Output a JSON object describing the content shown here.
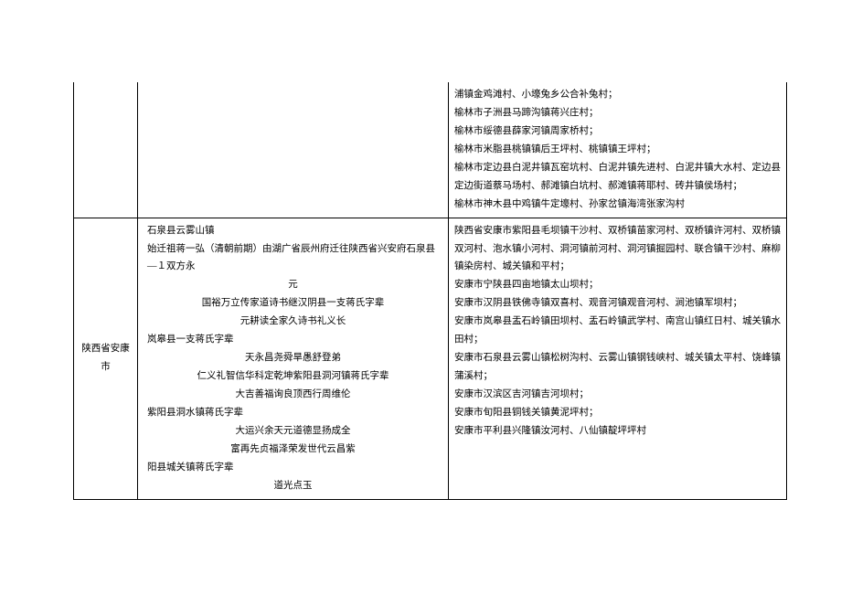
{
  "row1": {
    "col1": "",
    "col2": "",
    "col3_lines": [
      "浦镇金鸡滩村、小壕兔乡公合补兔村；",
      "榆林市子洲县马蹄沟镇蒋兴庄村；",
      "榆林市绥德县薛家河镇周家桥村；",
      "榆林市米脂县桃镇镇后王坪村、桃镇镇王坪村；",
      "榆林市定边县白泥井镇瓦窑坑村、白泥井镇先进村、白泥井镇大水村、定边县定边街道蔡马场村、郝滩镇白坑村、郝滩镇蒋耶村、砖井镇侯场村；",
      "榆林市神木县中鸡镇牛定壕村、孙家岔镇海湾张家沟村"
    ]
  },
  "row2": {
    "col1": "陕西省安康市",
    "col2_lines": [
      {
        "cls": "left-line",
        "text": "石泉县云雾山镇"
      },
      {
        "cls": "left-line",
        "text": "始迁祖蒋一弘（清朝前期）由湖广省辰州府迁往陕西省兴安府石泉县—１双方永"
      },
      {
        "cls": "indent-center",
        "text": "元"
      },
      {
        "cls": "indent-center",
        "text": "国裕万立传家道诗书继汉阴县一支蒋氏字辈"
      },
      {
        "cls": "indent-center",
        "text": "元耕读全家久诗书礼义长"
      },
      {
        "cls": "left-line",
        "text": "岚皋县一支蒋氏字辈"
      },
      {
        "cls": "indent-center",
        "text": "天永昌尧舜旱愚舒登弟"
      },
      {
        "cls": "indent-center",
        "text": "仁义礼智信华科定乾坤紫阳县洞河镇蒋氏字辈"
      },
      {
        "cls": "indent-center",
        "text": "大吉善福询良顶西行周维伦"
      },
      {
        "cls": "left-line",
        "text": "紫阳县洞水镇蒋氏字辈"
      },
      {
        "cls": "indent-center",
        "text": "大运兴余天元道德显扬成全"
      },
      {
        "cls": "indent-center",
        "text": "富再先贞福泽荣发世代云昌紫"
      },
      {
        "cls": "left-line",
        "text": "阳县城关镇蒋氏字辈"
      },
      {
        "cls": "indent-center",
        "text": "道光点玉"
      }
    ],
    "col3_lines": [
      "陕西省安康市紫阳县毛坝镇干沙村、双桥镇苗家河村、双桥镇许河村、双桥镇双河村、泡水镇小河村、洞河镇前河村、洞河镇掘园村、联合镇干沙村、麻柳镇染房村、城关镇和平村；",
      "安康市宁陕县四亩地镇太山坝村；",
      "安康市汉阴县铁佛寺镇双喜村、观音河镇观音河村、涧池镇军坝村；",
      "安康市岚皋县盂石岭镇田坝村、盂石岭镇武学村、南宫山镇红日村、城关镇水田村；",
      "安康市石泉县云雾山镇松树沟村、云雾山镇钢钱峡村、城关镇太平村、饶峰镇蒲溪村；",
      "安康市汉滨区吉河镇吉河坝村；",
      "安康市旬阳县铜钱关镇黄泥坪村；",
      "安康市平利县兴隆镇汝河村、八仙镇靛坪坪村"
    ]
  }
}
